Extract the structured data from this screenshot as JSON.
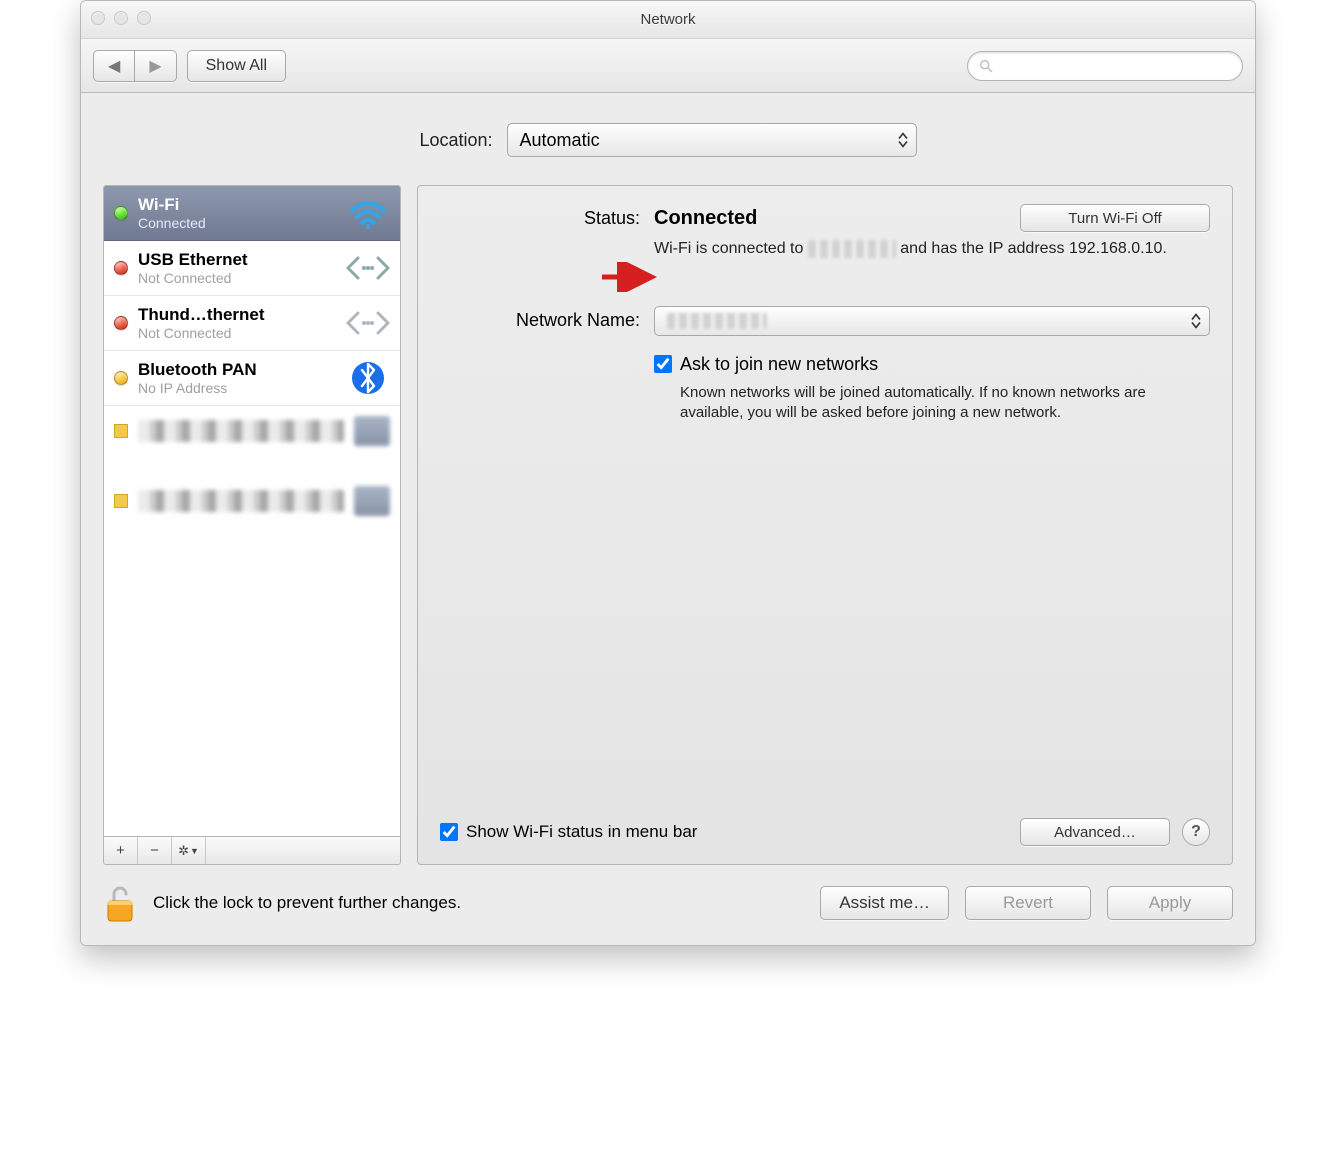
{
  "window": {
    "title": "Network"
  },
  "toolbar": {
    "back_label": "◀",
    "forward_label": "▶",
    "showall_label": "Show All",
    "search_placeholder": ""
  },
  "location": {
    "label": "Location:",
    "value": "Automatic"
  },
  "services": [
    {
      "name": "Wi-Fi",
      "status": "Connected",
      "icon": "wifi",
      "dot": "green",
      "selected": true
    },
    {
      "name": "USB Ethernet",
      "status": "Not Connected",
      "icon": "ethernet",
      "dot": "red",
      "selected": false
    },
    {
      "name": "Thund…thernet",
      "status": "Not Connected",
      "icon": "ethernet",
      "dot": "red",
      "selected": false
    },
    {
      "name": "Bluetooth PAN",
      "status": "No IP Address",
      "icon": "bluetooth",
      "dot": "yellow",
      "selected": false
    }
  ],
  "list_actions": {
    "add": "+",
    "remove": "−",
    "gear": "✻▾"
  },
  "detail": {
    "status_label": "Status:",
    "status_value": "Connected",
    "turn_off_label": "Turn Wi-Fi Off",
    "status_sub_prefix": "Wi-Fi is connected to ",
    "status_sub_suffix": " and has the IP address 192.168.0.10.",
    "network_name_label": "Network Name:",
    "ask_join_label": "Ask to join new networks",
    "ask_join_hint": "Known networks will be joined automatically. If no known networks are available, you will be asked before joining a new network.",
    "show_menubar_label": "Show Wi-Fi status in menu bar",
    "advanced_label": "Advanced…",
    "help_label": "?"
  },
  "footer": {
    "lock_text": "Click the lock to prevent further changes.",
    "assist_label": "Assist me…",
    "revert_label": "Revert",
    "apply_label": "Apply"
  }
}
